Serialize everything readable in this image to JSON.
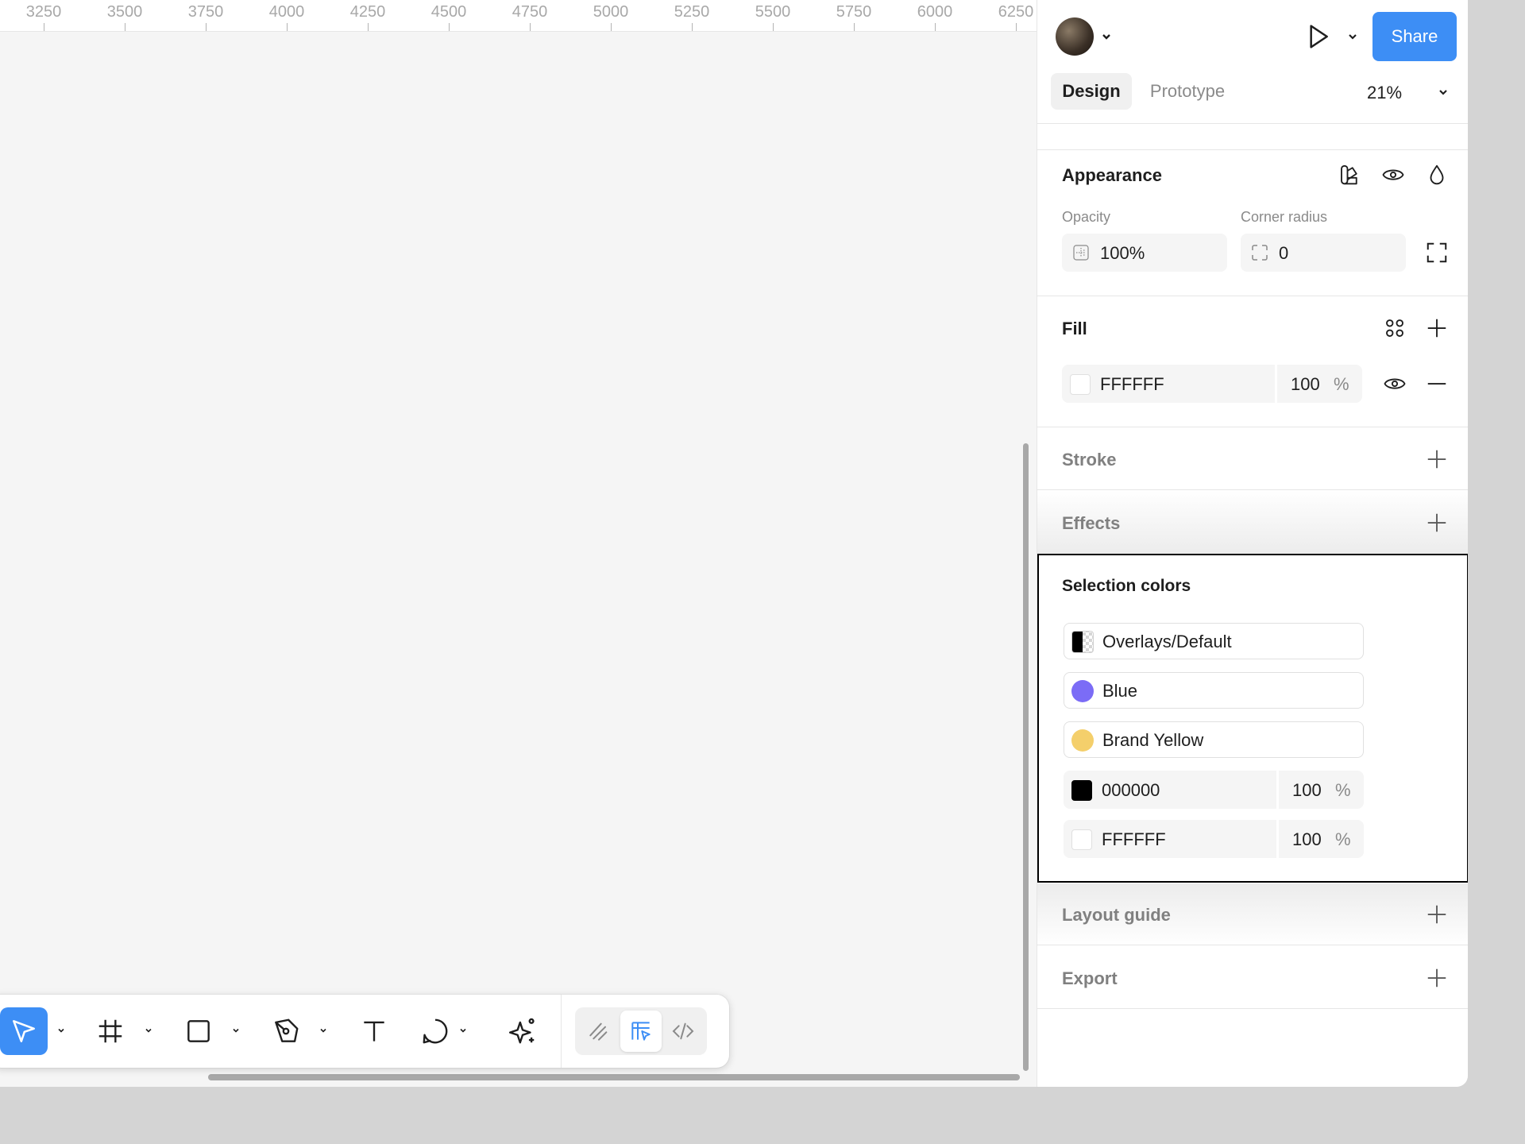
{
  "ruler": {
    "ticks": [
      "3250",
      "3500",
      "3750",
      "4000",
      "4250",
      "4500",
      "4750",
      "5000",
      "5250",
      "5500",
      "5750",
      "6000",
      "6250"
    ]
  },
  "header": {
    "share_label": "Share",
    "tabs": [
      {
        "label": "Design",
        "active": true
      },
      {
        "label": "Prototype",
        "active": false
      }
    ],
    "zoom": "21%"
  },
  "appearance": {
    "title": "Appearance",
    "opacity_label": "Opacity",
    "opacity_value": "100%",
    "corner_label": "Corner radius",
    "corner_value": "0"
  },
  "fill": {
    "title": "Fill",
    "hex": "FFFFFF",
    "opacity": "100",
    "unit": "%"
  },
  "stroke": {
    "title": "Stroke"
  },
  "effects": {
    "title": "Effects"
  },
  "selection_colors": {
    "title": "Selection colors",
    "styles": [
      {
        "label": "Overlays/Default"
      },
      {
        "label": "Blue",
        "color": "#7b6cf6"
      },
      {
        "label": "Brand Yellow",
        "color": "#f4cf6b"
      }
    ],
    "colors": [
      {
        "hex": "000000",
        "opacity": "100",
        "unit": "%",
        "color": "#000000"
      },
      {
        "hex": "FFFFFF",
        "opacity": "100",
        "unit": "%",
        "color": "#ffffff"
      }
    ]
  },
  "layout_guide": {
    "title": "Layout guide"
  },
  "export": {
    "title": "Export"
  },
  "colors": {
    "accent": "#3d8ef5",
    "canvas": "#f5f5f5",
    "panel": "#ffffff"
  }
}
